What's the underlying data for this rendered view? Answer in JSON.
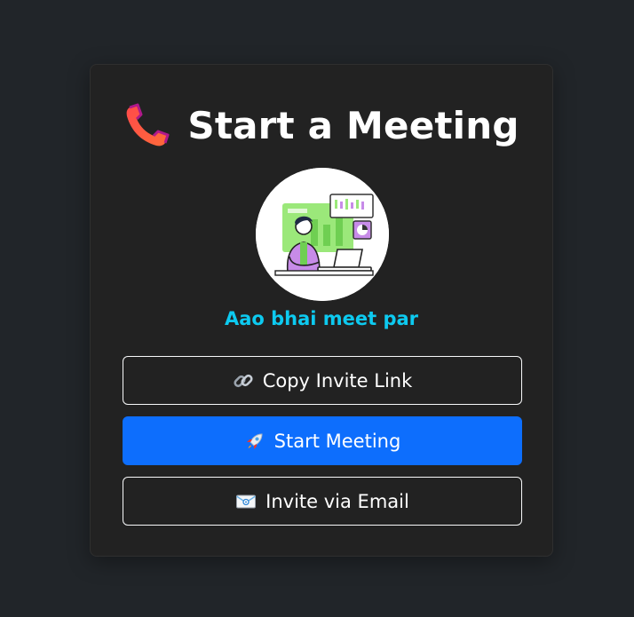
{
  "meeting_card": {
    "title": "Start a Meeting",
    "title_icon": "telephone-receiver-icon",
    "avatar_image": "developer-at-laptop-illustration",
    "tagline": "Aao bhai meet par",
    "tagline_color": "#0dcaf0",
    "buttons": {
      "copy_link": {
        "label": "Copy Invite Link",
        "icon": "link-icon"
      },
      "start_meeting": {
        "label": "Start Meeting",
        "icon": "rocket-icon",
        "color": "#0d6efd"
      },
      "invite_email": {
        "label": "Invite via Email",
        "icon": "email-envelope-icon"
      }
    }
  }
}
